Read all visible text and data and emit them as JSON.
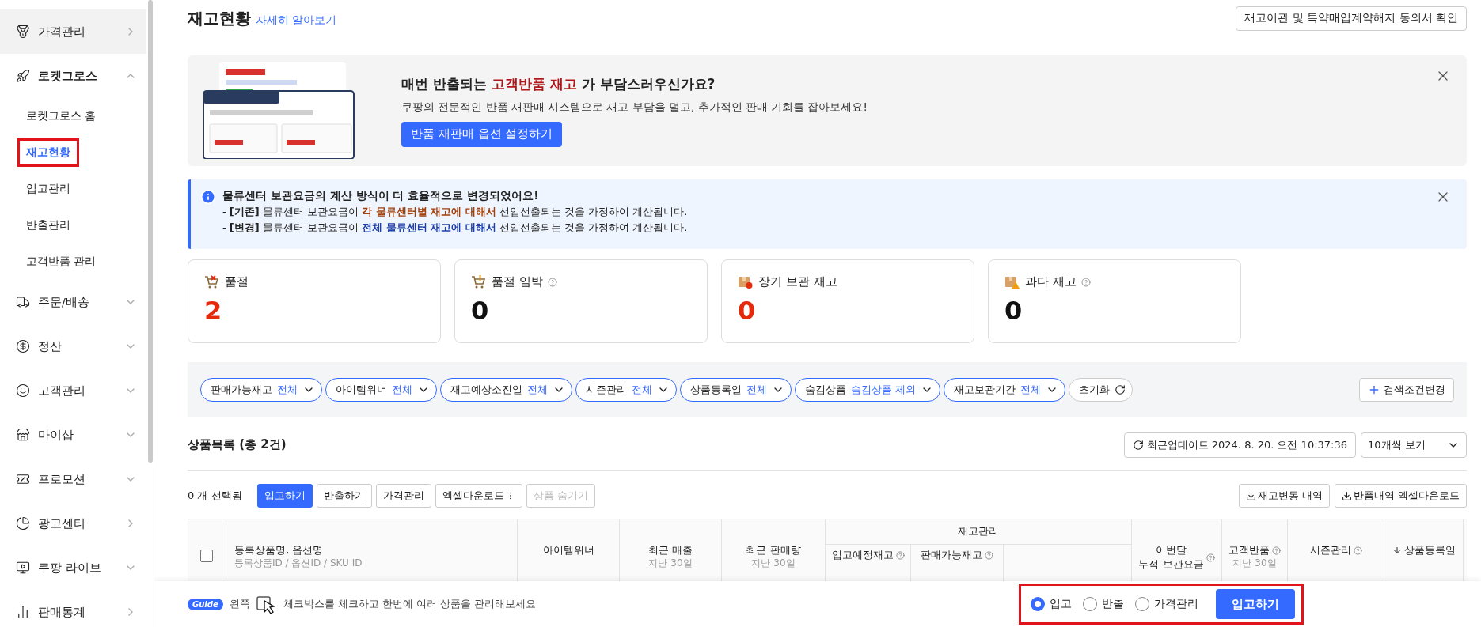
{
  "sidebar": {
    "items": [
      {
        "label": "가격관리",
        "kind": "link",
        "expanded": false,
        "hovered": true
      },
      {
        "label": "로켓그로스",
        "kind": "group",
        "expanded": true,
        "hovered": false,
        "children": [
          {
            "label": "로켓그로스 홈",
            "selected": false,
            "annotated": false
          },
          {
            "label": "재고현황",
            "selected": true,
            "annotated": true
          },
          {
            "label": "입고관리",
            "selected": false,
            "annotated": false
          },
          {
            "label": "반출관리",
            "selected": false,
            "annotated": false
          },
          {
            "label": "고객반품 관리",
            "selected": false,
            "annotated": false
          }
        ]
      },
      {
        "label": "주문/배송",
        "kind": "group",
        "expanded": false,
        "hovered": false
      },
      {
        "label": "정산",
        "kind": "group",
        "expanded": false,
        "hovered": false
      },
      {
        "label": "고객관리",
        "kind": "group",
        "expanded": false,
        "hovered": false
      },
      {
        "label": "마이샵",
        "kind": "group",
        "expanded": false,
        "hovered": false
      },
      {
        "label": "프로모션",
        "kind": "group",
        "expanded": false,
        "hovered": false
      },
      {
        "label": "광고센터",
        "kind": "link",
        "expanded": false,
        "hovered": false
      },
      {
        "label": "쿠팡 라이브",
        "kind": "group",
        "expanded": false,
        "hovered": false
      },
      {
        "label": "판매통계",
        "kind": "link",
        "expanded": false,
        "hovered": false
      }
    ]
  },
  "header": {
    "title": "재고현황",
    "help_link": "자세히 알아보기",
    "action": "재고이관 및 특약매입계약해지 동의서 확인"
  },
  "banner": {
    "headline": [
      {
        "text": "매번 반출되는 "
      },
      {
        "text": "고객반품 재고",
        "color": "#b0171a"
      },
      {
        "text": " 가 부담스러우신가요?"
      }
    ],
    "description": "쿠팡의 전문적인 반품 재판매 시스템으로 재고 부담을 덜고, 추가적인 판매 기회를 잡아보세요!",
    "button": "반품 재판매 옵션 설정하기"
  },
  "notice": {
    "title": "물류센터 보관요금의 계산 방식이 더 효율적으로 변경되었어요!",
    "lines": [
      [
        {
          "text": "- "
        },
        {
          "text": "[기존]",
          "bold": true
        },
        {
          "text": " 물류센터 보관요금이 "
        },
        {
          "text": "각 물류센터별 재고에 대해서",
          "bold": true,
          "color": "#a0400c"
        },
        {
          "text": " 선입선출되는 것을 가정하여 계산됩니다."
        }
      ],
      [
        {
          "text": "- "
        },
        {
          "text": "[변경]",
          "bold": true
        },
        {
          "text": " 물류센터 보관요금이 "
        },
        {
          "text": "전체 물류센터 재고에 대해서",
          "bold": true,
          "color": "#1e3fa8"
        },
        {
          "text": " 선입선출되는 것을 가정하여 계산됩니다."
        }
      ]
    ]
  },
  "summary_cards": [
    {
      "label": "품절",
      "value": "2",
      "alert": true,
      "help": false
    },
    {
      "label": "품절 임박",
      "value": "0",
      "alert": false,
      "help": true
    },
    {
      "label": "장기 보관 재고",
      "value": "0",
      "alert": true,
      "help": false
    },
    {
      "label": "과다 재고",
      "value": "0",
      "alert": false,
      "help": true
    }
  ],
  "filters": {
    "chips": [
      {
        "label": "판매가능재고",
        "value": "전체"
      },
      {
        "label": "아이템위너",
        "value": "전체"
      },
      {
        "label": "재고예상소진일",
        "value": "전체"
      },
      {
        "label": "시즌관리",
        "value": "전체"
      },
      {
        "label": "상품등록일",
        "value": "전체"
      },
      {
        "label": "숨김상품",
        "value": "숨김상품 제외"
      },
      {
        "label": "재고보관기간",
        "value": "전체"
      }
    ],
    "reset": "초기화",
    "change": "검색조건변경"
  },
  "product_list": {
    "title": "상품목록 (총 2건)",
    "updated": "최근업데이트 2024. 8. 20. 오전 10:37:36",
    "page_size": "10개씩 보기",
    "selected_count": "0 개 선택됨",
    "actions": [
      {
        "label": "입고하기",
        "kind": "primary",
        "disabled": false
      },
      {
        "label": "반출하기",
        "kind": "plain",
        "disabled": false
      },
      {
        "label": "가격관리",
        "kind": "plain",
        "disabled": false
      },
      {
        "label": "엑셀다운로드",
        "kind": "menu",
        "disabled": false
      },
      {
        "label": "상품 숨기기",
        "kind": "plain",
        "disabled": true
      }
    ],
    "downloads": [
      "재고변동 내역",
      "반품내역 엑셀다운로드"
    ]
  },
  "table": {
    "columns": [
      {
        "kind": "checkbox",
        "checked": false
      },
      {
        "kind": "text",
        "label": "등록상품명, 옵션명",
        "sublabel": "등록상품ID / 옵션ID / SKU ID"
      },
      {
        "kind": "text",
        "label": "아이템위너"
      },
      {
        "kind": "text",
        "label": "최근 매출",
        "sublabel": "지난 30일"
      },
      {
        "kind": "text",
        "label": "최근 판매량",
        "sublabel": "지난 30일"
      },
      {
        "kind": "group",
        "label": "재고관리",
        "children": [
          {
            "kind": "text",
            "label": "입고예정재고",
            "help": true
          },
          {
            "kind": "text",
            "label": "판매가능재고",
            "help": true
          },
          {
            "kind": "blank"
          }
        ]
      },
      {
        "kind": "text",
        "lines": [
          "이번달",
          "누적 보관요금"
        ],
        "help": true
      },
      {
        "kind": "text",
        "label": "고객반품",
        "help": true,
        "sublabel": "지난 30일"
      },
      {
        "kind": "text",
        "label": "시즌관리",
        "help": true
      },
      {
        "kind": "text",
        "label": "상품등록일",
        "sorted_descending": true
      }
    ]
  },
  "guide_bar": {
    "badge": "Guide",
    "before": "왼쪽",
    "text": "체크박스를 체크하고 한번에 여러 상품을 관리해보세요",
    "annotated": true,
    "options": [
      {
        "label": "입고",
        "selected": true
      },
      {
        "label": "반출",
        "selected": false
      },
      {
        "label": "가격관리",
        "selected": false
      }
    ],
    "button": "입고하기"
  }
}
